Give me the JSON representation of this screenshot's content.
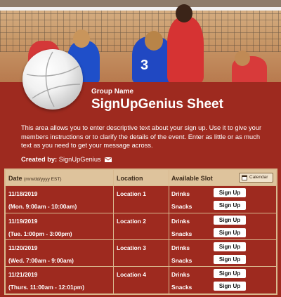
{
  "header": {
    "group_name": "Group Name",
    "title": "SignUpGenius Sheet",
    "description": "This area allows you to enter descriptive text about your sign up. Use it to give your members instructions or to clarify the details of the event. Enter as little or as much text as you need to get your message across.",
    "created_by_label": "Created by:",
    "created_by_name": "SignUpGenius"
  },
  "table": {
    "col_date": "Date",
    "col_date_hint": "(mm/dd/yyyy EST)",
    "col_location": "Location",
    "col_slot": "Available Slot",
    "calendar_label": "Calendar",
    "rows": [
      {
        "date": "11/18/2019",
        "time": "(Mon. 9:00am - 10:00am)",
        "location": "Location 1",
        "slot1": "Drinks",
        "slot2": "Snacks",
        "button": "Sign Up"
      },
      {
        "date": "11/19/2019",
        "time": "(Tue. 1:00pm - 3:00pm)",
        "location": "Location 2",
        "slot1": "Drinks",
        "slot2": "Snacks",
        "button": "Sign Up"
      },
      {
        "date": "11/20/2019",
        "time": "(Wed. 7:00am - 9:00am)",
        "location": "Location 3",
        "slot1": "Drinks",
        "slot2": "Snacks",
        "button": "Sign Up"
      },
      {
        "date": "11/21/2019",
        "time": "(Thurs. 11:00am - 12:01pm)",
        "location": "Location 4",
        "slot1": "Drinks",
        "slot2": "Snacks",
        "button": "Sign Up"
      }
    ]
  },
  "banner": {
    "jersey_number": "3"
  },
  "colors": {
    "background": "#9e2a1f",
    "table_header": "#dec39c",
    "border": "#d9b98f"
  }
}
